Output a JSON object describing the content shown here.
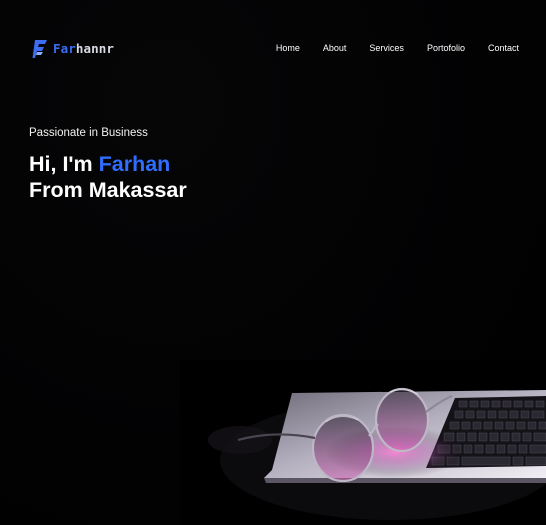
{
  "header": {
    "logo": {
      "accent_text": "Far",
      "rest_text": "hannr",
      "icon": "f-monogram-icon",
      "accent_color": "#3d6df2"
    },
    "nav": [
      {
        "label": "Home"
      },
      {
        "label": "About"
      },
      {
        "label": "Services"
      },
      {
        "label": "Portofolio"
      },
      {
        "label": "Contact"
      }
    ]
  },
  "hero": {
    "tagline": "Passionate in Business",
    "greeting": "Hi, I'm ",
    "name": "Farhan",
    "location_line": "From Makassar",
    "name_color": "#2f6dff",
    "image": "laptop-and-glasses-photo"
  },
  "colors": {
    "background": "#000000",
    "text": "#ffffff",
    "accent": "#2f6dff"
  }
}
